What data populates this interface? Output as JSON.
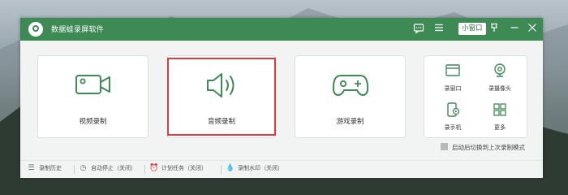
{
  "window": {
    "title": "数据蛙录屏软件",
    "mini_window_label": "小窗口"
  },
  "titlebar_icons": [
    "chat-icon",
    "menu-icon",
    "pin-icon",
    "minimize-icon",
    "close-icon"
  ],
  "cards": {
    "video": {
      "label": "视频录制",
      "icon": "video-camera-icon"
    },
    "audio": {
      "label": "音频录制",
      "icon": "speaker-icon"
    },
    "game": {
      "label": "游戏录制",
      "icon": "gamepad-icon"
    }
  },
  "more_tools": [
    {
      "label": "录窗口",
      "icon": "window-record-icon"
    },
    {
      "label": "录摄像头",
      "icon": "webcam-icon"
    },
    {
      "label": "录手机",
      "icon": "phone-record-icon"
    },
    {
      "label": "更多",
      "icon": "grid-more-icon"
    }
  ],
  "auto_switch": {
    "label": "启动后切换到上次录制模式",
    "checked": false
  },
  "footer": {
    "history": "录制历史",
    "auto_stop": "自动停止（关闭）",
    "schedule": "计划任务（关闭）",
    "watermark": "录制水印（关闭）"
  },
  "colors": {
    "brand_green": "#3d8a55",
    "highlight_red": "#e03a3a"
  }
}
